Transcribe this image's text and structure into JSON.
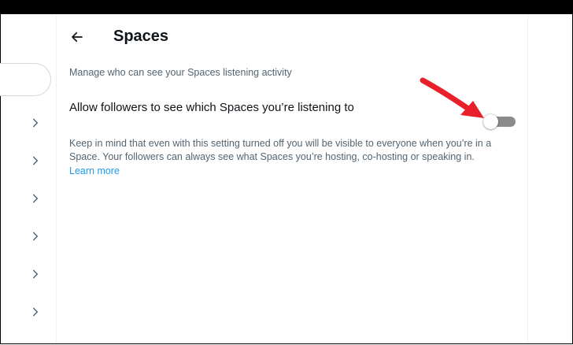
{
  "header": {
    "title": "Spaces"
  },
  "spaces": {
    "subtitle": "Manage who can see your Spaces listening activity",
    "setting_label": "Allow followers to see which Spaces you’re listening to",
    "toggle_on": false,
    "description": "Keep in mind that even with this setting turned off you will be visible to everyone when you’re in a Space. Your followers can always see what Spaces you’re hosting, co-hosting or speaking in.",
    "learn_more": "Learn more"
  },
  "colors": {
    "primary_text": "#0f1419",
    "secondary_text": "#536471",
    "link": "#1d9bf0",
    "toggle_off_track": "#8b8b8b",
    "annotation_arrow": "#e8202a"
  },
  "icons": {
    "back": "arrow-left-icon",
    "chevron": "chevron-right-icon",
    "annotation": "red-arrow-icon"
  }
}
